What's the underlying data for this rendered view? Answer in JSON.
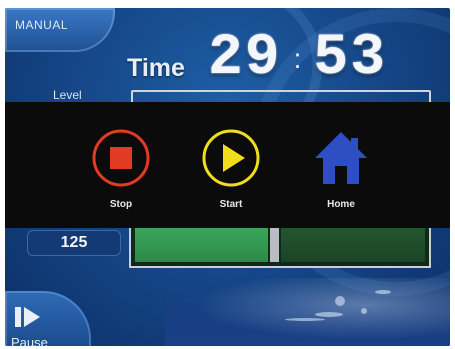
{
  "header": {
    "mode_label": "MANUAL",
    "time_label": "Time",
    "time_minutes": "29",
    "time_separator": ":",
    "time_seconds": "53"
  },
  "level": {
    "label": "Level"
  },
  "overlay_menu": {
    "stop": {
      "label": "Stop",
      "icon": "stop-icon",
      "color": "#e23b24"
    },
    "start": {
      "label": "Start",
      "icon": "play-icon",
      "color": "#f1de1a"
    },
    "home": {
      "label": "Home",
      "icon": "home-icon",
      "color": "#2e4fc4"
    }
  },
  "footer": {
    "value": "125",
    "progress_fraction": 0.46,
    "pause_label": "Pause",
    "pause_icon": "pause-play-icon"
  },
  "colors": {
    "background": "#16488a",
    "overlay": "#0b0b0c",
    "progress_fill": "#2c8a49"
  }
}
